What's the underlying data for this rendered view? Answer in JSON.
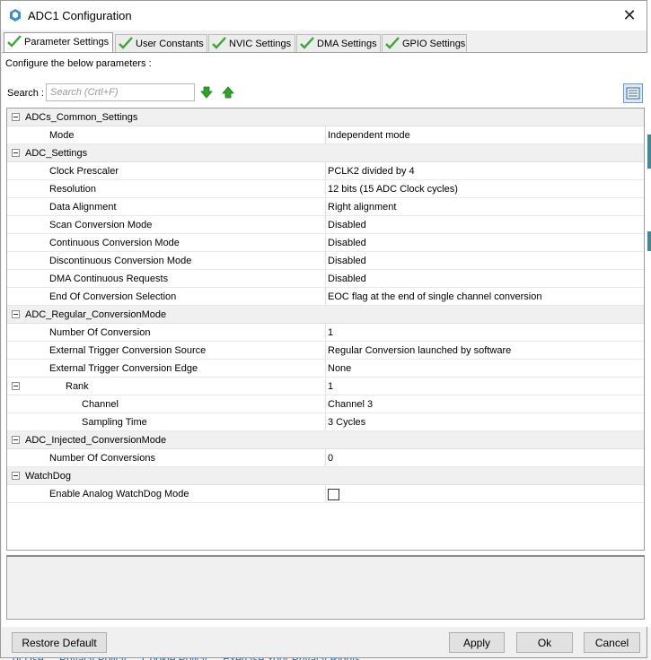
{
  "window": {
    "title": "ADC1 Configuration",
    "close_glyph": "✕"
  },
  "background_links": [
    "of Use",
    "Privacy Policy",
    "Cookie Policy",
    "Exercise Your Privacy Rights"
  ],
  "tabs": [
    {
      "label": "Parameter Settings",
      "active": true
    },
    {
      "label": "User Constants",
      "active": false
    },
    {
      "label": "NVIC Settings",
      "active": false
    },
    {
      "label": "DMA Settings",
      "active": false
    },
    {
      "label": "GPIO Settings",
      "active": false
    }
  ],
  "content": {
    "configure_label": "Configure the below parameters :",
    "search_label": "Search :",
    "search_placeholder": "Search (Crtl+F)",
    "search_value": ""
  },
  "parameters": [
    {
      "name": "ADCs_Common_Settings",
      "value": "",
      "group": true
    },
    {
      "name": "Mode",
      "value": "Independent mode"
    },
    {
      "name": "ADC_Settings",
      "value": "",
      "group": true
    },
    {
      "name": "Clock Prescaler",
      "value": "PCLK2 divided by 4"
    },
    {
      "name": "Resolution",
      "value": "12 bits (15 ADC Clock cycles)"
    },
    {
      "name": "Data Alignment",
      "value": "Right alignment"
    },
    {
      "name": "Scan Conversion Mode",
      "value": "Disabled"
    },
    {
      "name": "Continuous Conversion Mode",
      "value": "Disabled"
    },
    {
      "name": "Discontinuous Conversion Mode",
      "value": "Disabled"
    },
    {
      "name": "DMA Continuous Requests",
      "value": "Disabled"
    },
    {
      "name": "End Of Conversion Selection",
      "value": "EOC flag at the end of single channel conversion"
    },
    {
      "name": "ADC_Regular_ConversionMode",
      "value": "",
      "group": true
    },
    {
      "name": "Number Of Conversion",
      "value": "1"
    },
    {
      "name": "External Trigger Conversion Source",
      "value": "Regular Conversion launched by software"
    },
    {
      "name": "External Trigger Conversion Edge",
      "value": "None"
    },
    {
      "name": "Rank",
      "value": "1",
      "subgroup": true
    },
    {
      "name": "Channel",
      "value": "Channel 3",
      "indent2": true
    },
    {
      "name": "Sampling Time",
      "value": "3 Cycles",
      "indent2": true
    },
    {
      "name": "ADC_Injected_ConversionMode",
      "value": "",
      "group": true
    },
    {
      "name": "Number Of Conversions",
      "value": "0"
    },
    {
      "name": "WatchDog",
      "value": "",
      "group": true
    },
    {
      "name": "Enable Analog WatchDog Mode",
      "value": "",
      "checkbox": true,
      "checked": false
    }
  ],
  "buttons": {
    "restore_default": "Restore Default",
    "apply": "Apply",
    "ok": "Ok",
    "cancel": "Cancel"
  },
  "colors": {
    "check_green": "#3aa635",
    "arrow_green": "#2ea12a",
    "title_icon": "#3b8fd1"
  },
  "icons": {
    "title": "stm32-cube-icon",
    "tab_status": "green-check-icon",
    "search_next": "arrow-down-icon",
    "search_prev": "arrow-up-icon",
    "view_toggle": "list-view-icon"
  }
}
